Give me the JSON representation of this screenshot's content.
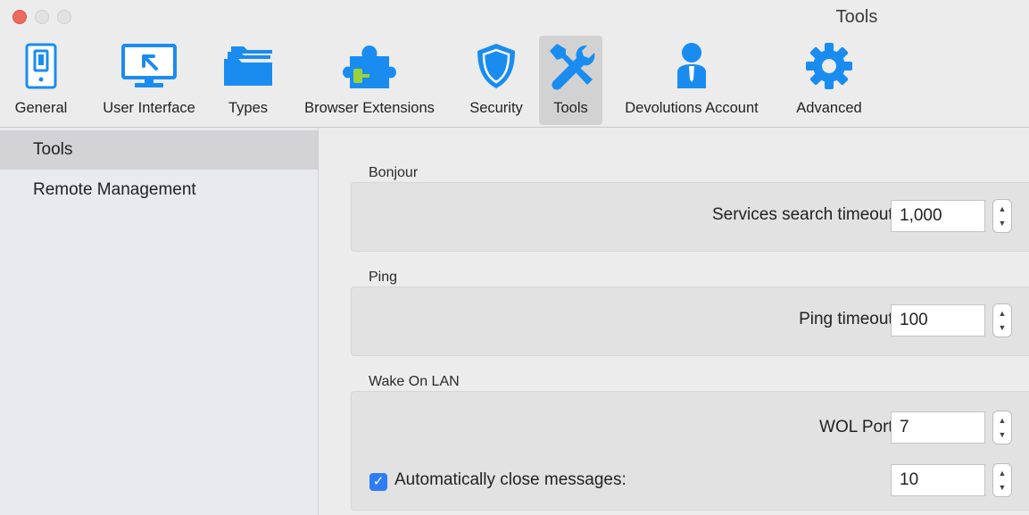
{
  "window": {
    "title": "Tools"
  },
  "toolbar": {
    "items": [
      {
        "label": "General",
        "icon": "switch-icon"
      },
      {
        "label": "User Interface",
        "icon": "monitor-icon"
      },
      {
        "label": "Types",
        "icon": "folders-icon"
      },
      {
        "label": "Browser Extensions",
        "icon": "puzzle-icon"
      },
      {
        "label": "Security",
        "icon": "shield-icon"
      },
      {
        "label": "Tools",
        "icon": "tools-icon",
        "selected": true
      },
      {
        "label": "Devolutions Account",
        "icon": "person-icon"
      },
      {
        "label": "Advanced",
        "icon": "gear-icon"
      }
    ]
  },
  "sidebar": {
    "items": [
      {
        "label": "Tools",
        "selected": true
      },
      {
        "label": "Remote Management"
      }
    ]
  },
  "groups": {
    "bonjour": {
      "title": "Bonjour",
      "services_search_timeout": {
        "label": "Services search timeout:",
        "value": "1,000"
      }
    },
    "ping": {
      "title": "Ping",
      "ping_timeout": {
        "label": "Ping timeout:",
        "value": "100"
      }
    },
    "wol": {
      "title": "Wake On LAN",
      "port": {
        "label": "WOL Port:",
        "value": "7"
      },
      "auto_close": {
        "label": "Automatically close messages:",
        "value": "10",
        "checked": true
      }
    }
  },
  "colors": {
    "accent": "#1a8cf0",
    "close": "#ed6a5e",
    "checkbox": "#2f7df6"
  }
}
